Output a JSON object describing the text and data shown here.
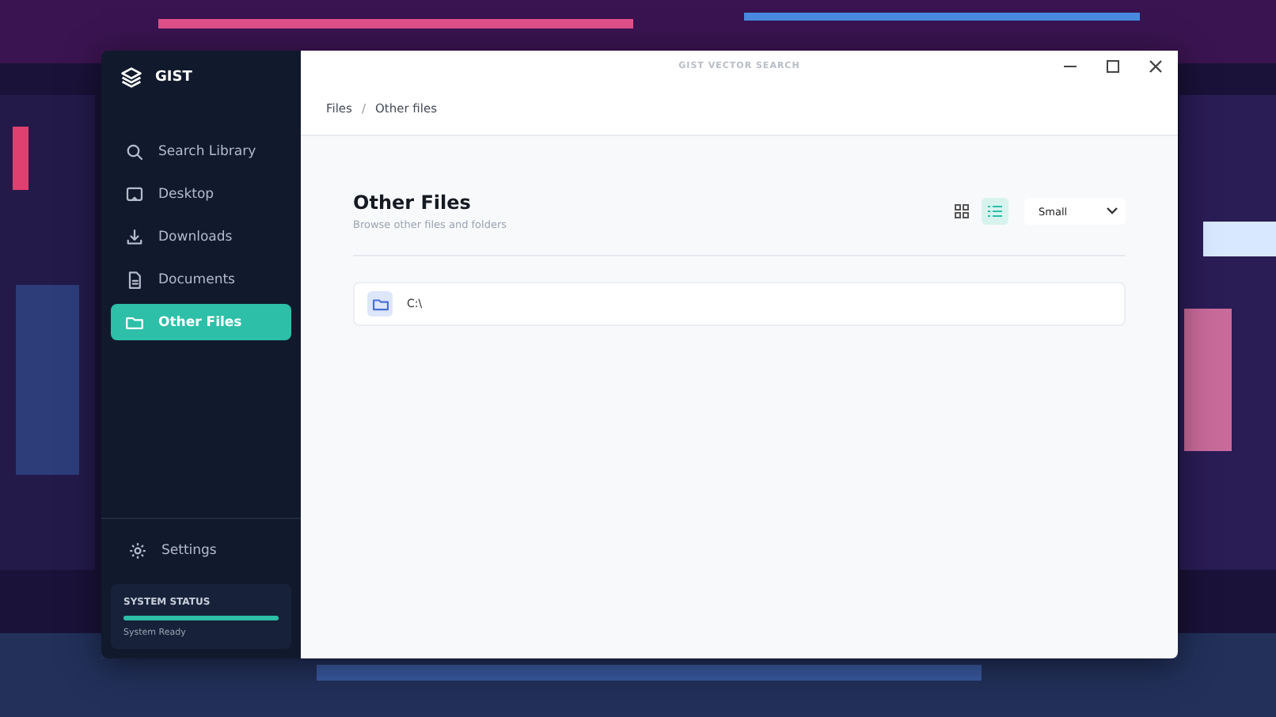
{
  "window": {
    "title": "GIST VECTOR SEARCH"
  },
  "sidebar": {
    "app_name": "GIST",
    "items": [
      {
        "label": "Search Library",
        "kind": "search",
        "selected": false
      },
      {
        "label": "Desktop",
        "kind": "desktop",
        "selected": false
      },
      {
        "label": "Downloads",
        "kind": "download",
        "selected": false
      },
      {
        "label": "Documents",
        "kind": "document",
        "selected": false
      },
      {
        "label": "Other Files",
        "kind": "folder",
        "selected": true
      }
    ],
    "settings": {
      "label": "Settings"
    },
    "system_status": {
      "title": "SYSTEM STATUS",
      "level": 1,
      "message": "System Ready"
    }
  },
  "breadcrumb": {
    "items": [
      "Files",
      "Other files"
    ],
    "separator": "/"
  },
  "page": {
    "title": "Other Files",
    "subtitle": "Browse other files and folders",
    "views": [
      {
        "kind": "grid",
        "selected": false
      },
      {
        "kind": "list",
        "selected": true
      }
    ],
    "size": "Small"
  },
  "files": [
    {
      "name": "C:\\"
    }
  ]
}
